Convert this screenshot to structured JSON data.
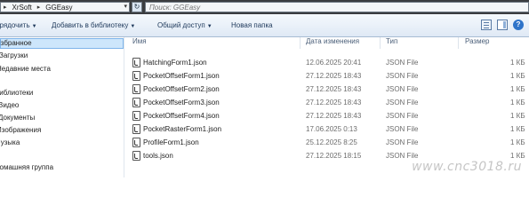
{
  "address_bar": {
    "breadcrumb": [
      "XrSoft",
      "GGEasy"
    ],
    "search_placeholder": "Поиск: GGEasy"
  },
  "toolbar": {
    "organize": "Упорядочить",
    "add_to_library": "Добавить в библиотеку",
    "share": "Общий доступ",
    "new_folder": "Новая папка"
  },
  "sidebar": {
    "items": [
      {
        "label": "Избранное",
        "selected": true
      },
      {
        "label": "Загрузки"
      },
      {
        "label": "Недавние места"
      },
      {
        "label": "Библиотеки"
      },
      {
        "label": "Видео"
      },
      {
        "label": "Документы"
      },
      {
        "label": "Изображения"
      },
      {
        "label": "Музыка"
      },
      {
        "label": "Домашняя группа"
      }
    ]
  },
  "columns": [
    "Имя",
    "Дата изменения",
    "Тип",
    "Размер"
  ],
  "files": [
    {
      "name": "HatchingForm1.json",
      "date": "12.06.2025 20:41",
      "type": "JSON File",
      "size": "1 КБ"
    },
    {
      "name": "PocketOffsetForm1.json",
      "date": "27.12.2025 18:43",
      "type": "JSON File",
      "size": "1 КБ"
    },
    {
      "name": "PocketOffsetForm2.json",
      "date": "27.12.2025 18:43",
      "type": "JSON File",
      "size": "1 КБ"
    },
    {
      "name": "PocketOffsetForm3.json",
      "date": "27.12.2025 18:43",
      "type": "JSON File",
      "size": "1 КБ"
    },
    {
      "name": "PocketOffsetForm4.json",
      "date": "27.12.2025 18:43",
      "type": "JSON File",
      "size": "1 КБ"
    },
    {
      "name": "PocketRasterForm1.json",
      "date": "17.06.2025 0:13",
      "type": "JSON File",
      "size": "1 КБ"
    },
    {
      "name": "ProfileForm1.json",
      "date": "25.12.2025 8:25",
      "type": "JSON File",
      "size": "1 КБ"
    },
    {
      "name": "tools.json",
      "date": "27.12.2025 18:15",
      "type": "JSON File",
      "size": "1 КБ"
    }
  ],
  "watermark": "www.cnc3018.ru",
  "icons": {
    "refresh": "refresh-icon",
    "view": "view-options-icon",
    "pane": "preview-pane-icon",
    "help": "help-icon",
    "file": "json-file-icon"
  }
}
